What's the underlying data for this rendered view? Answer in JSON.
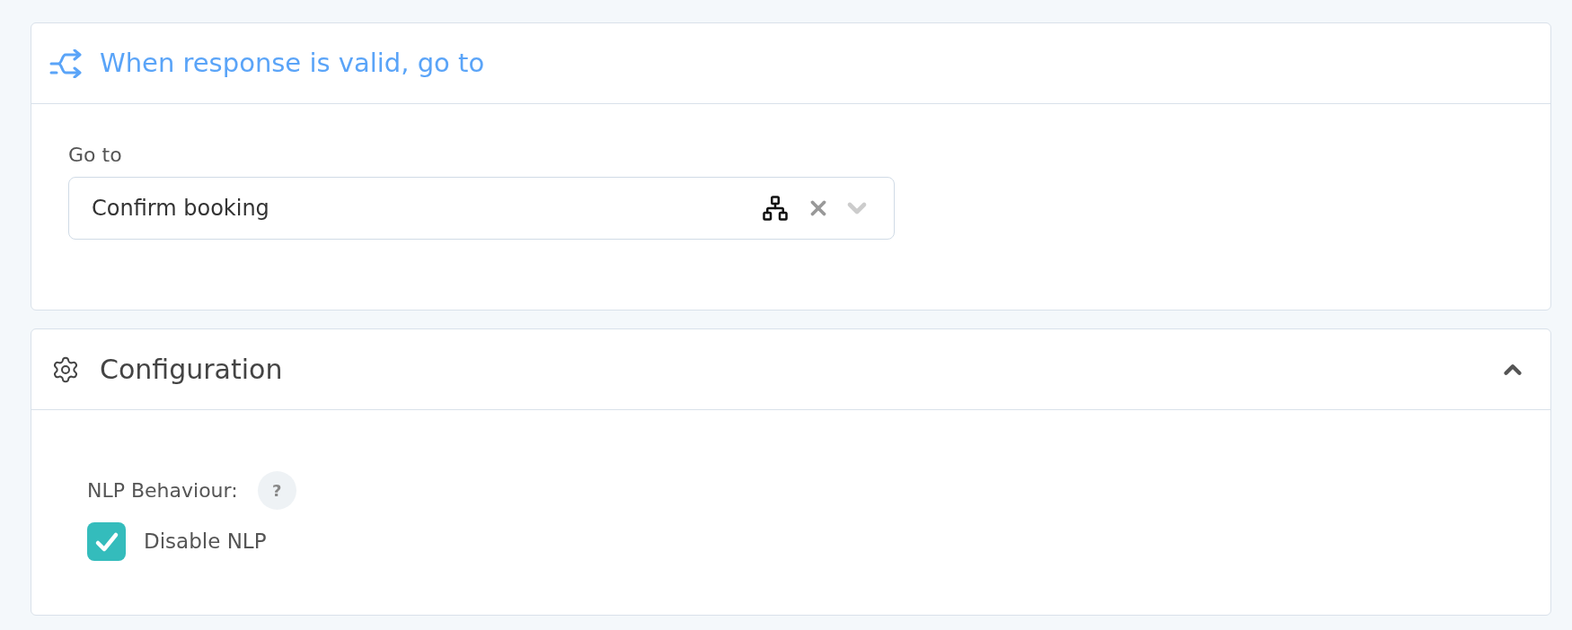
{
  "routing_card": {
    "title": "When response is valid, go to",
    "field_label": "Go to",
    "select": {
      "value": "Confirm booking"
    }
  },
  "configuration_card": {
    "title": "Configuration",
    "expanded": true,
    "nlp_label": "NLP Behaviour:",
    "help": "?",
    "checkbox": {
      "label": "Disable NLP",
      "checked": true
    }
  }
}
